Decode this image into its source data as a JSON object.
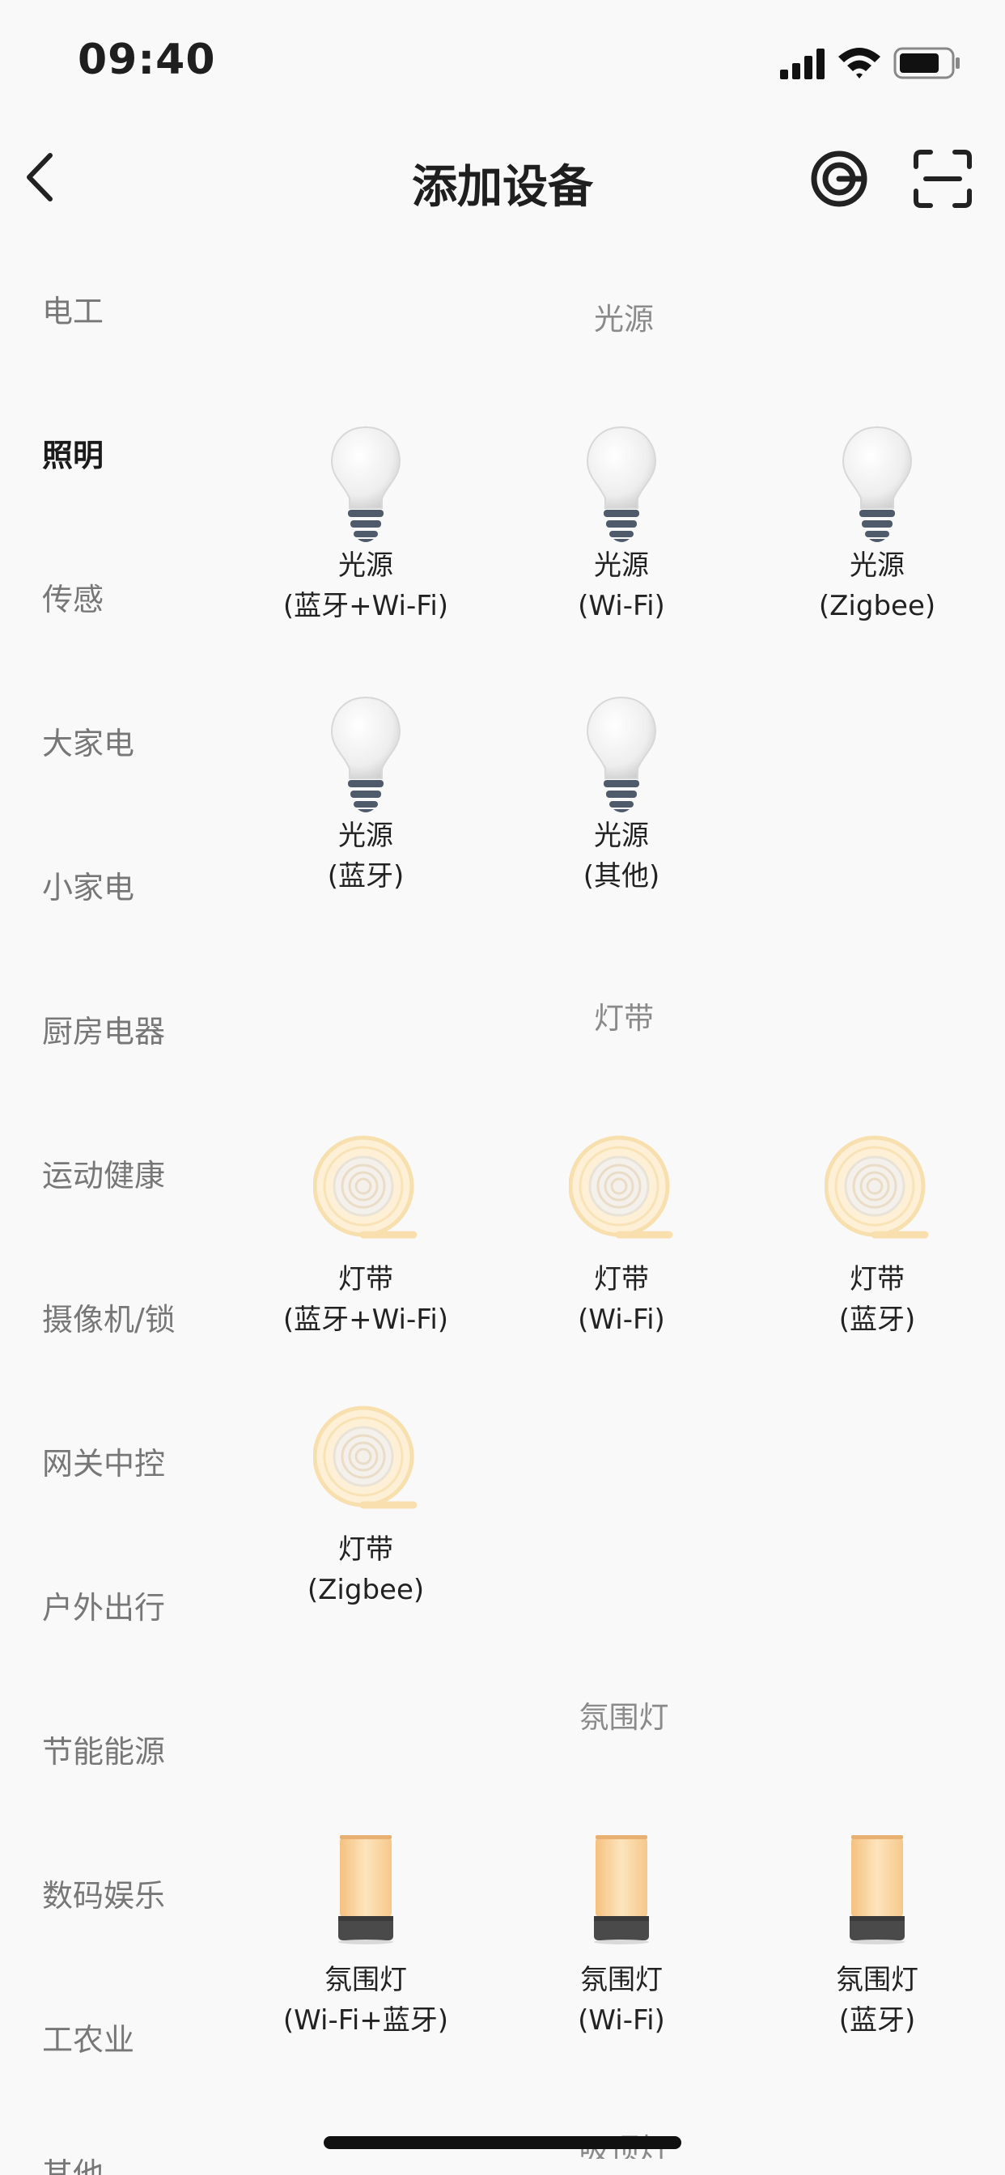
{
  "status_bar": {
    "time": "09:40"
  },
  "header": {
    "title": "添加设备"
  },
  "sidebar": {
    "items": [
      {
        "label": "电工",
        "active": false
      },
      {
        "label": "照明",
        "active": true
      },
      {
        "label": "传感",
        "active": false
      },
      {
        "label": "大家电",
        "active": false
      },
      {
        "label": "小家电",
        "active": false
      },
      {
        "label": "厨房电器",
        "active": false
      },
      {
        "label": "运动健康",
        "active": false
      },
      {
        "label": "摄像机/锁",
        "active": false
      },
      {
        "label": "网关中控",
        "active": false
      },
      {
        "label": "户外出行",
        "active": false
      },
      {
        "label": "节能能源",
        "active": false
      },
      {
        "label": "数码娱乐",
        "active": false
      },
      {
        "label": "工农业",
        "active": false
      },
      {
        "label": "其他",
        "active": false
      }
    ]
  },
  "sections": [
    {
      "title": "光源",
      "items": [
        {
          "line1": "光源",
          "line2": "(蓝牙+Wi-Fi)",
          "icon": "bulb-icon"
        },
        {
          "line1": "光源",
          "line2": "(Wi-Fi)",
          "icon": "bulb-icon"
        },
        {
          "line1": "光源",
          "line2": "(Zigbee)",
          "icon": "bulb-icon"
        },
        {
          "line1": "光源",
          "line2": "(蓝牙)",
          "icon": "bulb-icon"
        },
        {
          "line1": "光源",
          "line2": "(其他)",
          "icon": "bulb-icon"
        }
      ]
    },
    {
      "title": "灯带",
      "items": [
        {
          "line1": "灯带",
          "line2": "(蓝牙+Wi-Fi)",
          "icon": "light-strip-icon"
        },
        {
          "line1": "灯带",
          "line2": "(Wi-Fi)",
          "icon": "light-strip-icon"
        },
        {
          "line1": "灯带",
          "line2": "(蓝牙)",
          "icon": "light-strip-icon"
        },
        {
          "line1": "灯带",
          "line2": "(Zigbee)",
          "icon": "light-strip-icon"
        }
      ]
    },
    {
      "title": "氛围灯",
      "items": [
        {
          "line1": "氛围灯",
          "line2": "(Wi-Fi+蓝牙)",
          "icon": "ambient-lamp-icon"
        },
        {
          "line1": "氛围灯",
          "line2": "(Wi-Fi)",
          "icon": "ambient-lamp-icon"
        },
        {
          "line1": "氛围灯",
          "line2": "(蓝牙)",
          "icon": "ambient-lamp-icon"
        }
      ]
    },
    {
      "title": "吸顶灯",
      "items": []
    }
  ]
}
